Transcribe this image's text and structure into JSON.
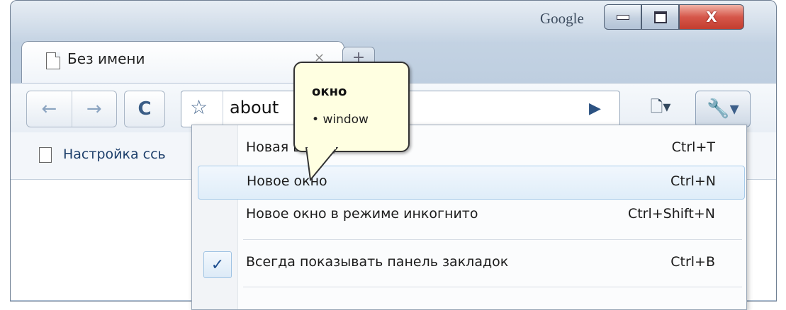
{
  "window": {
    "brand": "Google",
    "controls": {
      "minimize": "minimize",
      "maximize": "maximize",
      "close": "X"
    }
  },
  "tab": {
    "title": "Без имени",
    "close": "×"
  },
  "toolbar": {
    "back_icon": "←",
    "forward_icon": "→",
    "reload_icon": "C",
    "omnibox_value": "about",
    "go_icon": "▶",
    "page_menu_icon": "🗋▾",
    "wrench_icon": "🔧▾"
  },
  "bookmarks_bar": {
    "label": "Настройка ссь"
  },
  "tooltip": {
    "title": "окно",
    "item": "window"
  },
  "menu": {
    "items": [
      {
        "label": "Новая вкладка",
        "shortcut": "Ctrl+T"
      },
      {
        "label": "Новое окно",
        "shortcut": "Ctrl+N"
      },
      {
        "label": "Новое окно в режиме инкогнито",
        "shortcut": "Ctrl+Shift+N"
      },
      {
        "label": "Всегда показывать панель закладок",
        "shortcut": "Ctrl+B",
        "checked": true
      }
    ]
  },
  "colors": {
    "frame": "#b9cadd",
    "highlight": "#dfedf9",
    "tooltip_bg": "#ffffe1"
  }
}
